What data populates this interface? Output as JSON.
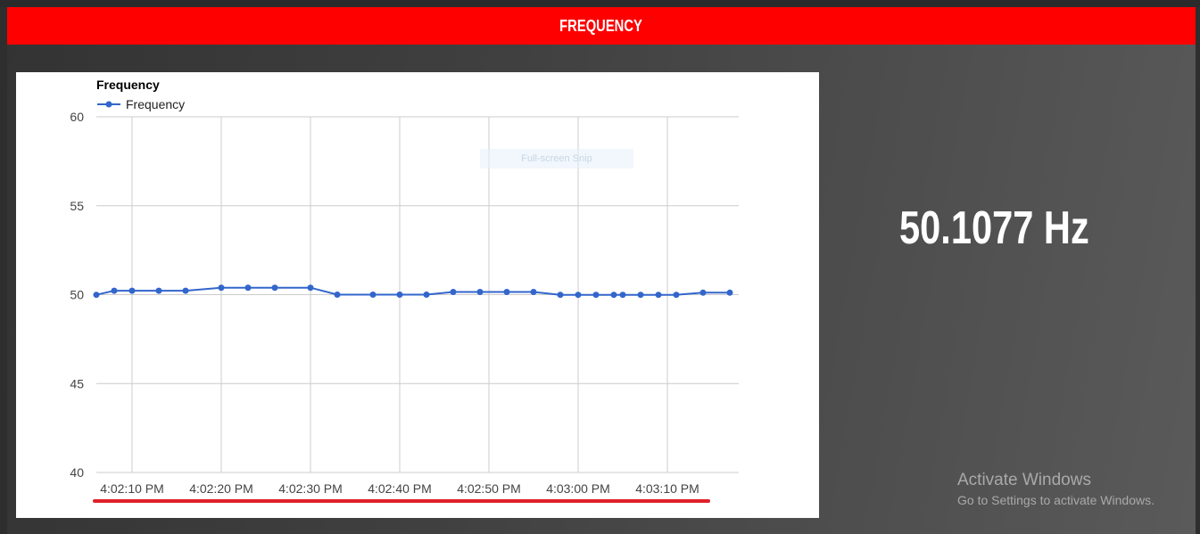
{
  "header": {
    "title": "FREQUENCY"
  },
  "readout": {
    "value": "50.1077 Hz"
  },
  "snip_overlay": {
    "label": "Full-screen Snip"
  },
  "watermark": {
    "title": "Activate Windows",
    "subtitle": "Go to Settings to activate Windows."
  },
  "colors": {
    "header": "#ff0000",
    "series": "#3366cc",
    "underline": "#e0202a",
    "grid": "#cccccc"
  },
  "chart_data": {
    "type": "line",
    "title": "Frequency",
    "legend": {
      "position": "top-left"
    },
    "grid": true,
    "ylim": [
      40,
      60
    ],
    "yticks": [
      40,
      45,
      50,
      55,
      60
    ],
    "xlim_seconds": [
      0,
      72
    ],
    "xticks": [
      {
        "t": 4,
        "label": "4:02:10 PM"
      },
      {
        "t": 14,
        "label": "4:02:20 PM"
      },
      {
        "t": 24,
        "label": "4:02:30 PM"
      },
      {
        "t": 34,
        "label": "4:02:40 PM"
      },
      {
        "t": 44,
        "label": "4:02:50 PM"
      },
      {
        "t": 54,
        "label": "4:03:00 PM"
      },
      {
        "t": 64,
        "label": "4:03:10 PM"
      }
    ],
    "series": [
      {
        "name": "Frequency",
        "points": [
          [
            0,
            49.99
          ],
          [
            2,
            50.22
          ],
          [
            4,
            50.22
          ],
          [
            7,
            50.22
          ],
          [
            10,
            50.22
          ],
          [
            14,
            50.39
          ],
          [
            17,
            50.39
          ],
          [
            20,
            50.39
          ],
          [
            24,
            50.39
          ],
          [
            27,
            50.0
          ],
          [
            31,
            50.0
          ],
          [
            34,
            50.0
          ],
          [
            37,
            50.0
          ],
          [
            40,
            50.15
          ],
          [
            43,
            50.15
          ],
          [
            46,
            50.15
          ],
          [
            49,
            50.15
          ],
          [
            52,
            49.99
          ],
          [
            54,
            49.99
          ],
          [
            56,
            49.99
          ],
          [
            58,
            49.99
          ],
          [
            59,
            49.99
          ],
          [
            61,
            49.99
          ],
          [
            63,
            49.99
          ],
          [
            65,
            49.99
          ],
          [
            68,
            50.11
          ],
          [
            71,
            50.11
          ]
        ]
      }
    ]
  }
}
